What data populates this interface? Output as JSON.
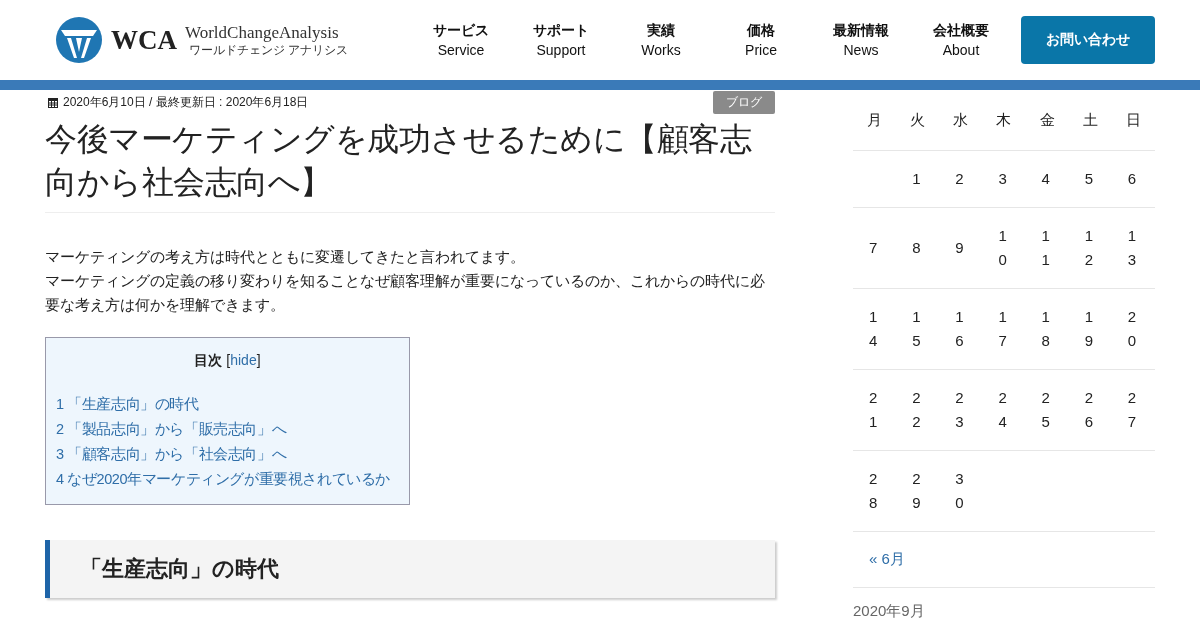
{
  "header": {
    "logo_mark": "WCA",
    "logo_name": "WorldChangeAnalysis",
    "logo_kana": "ワールドチェンジ アナリシス",
    "nav": [
      {
        "ja": "サービス",
        "en": "Service"
      },
      {
        "ja": "サポート",
        "en": "Support"
      },
      {
        "ja": "実績",
        "en": "Works"
      },
      {
        "ja": "価格",
        "en": "Price"
      },
      {
        "ja": "最新情報",
        "en": "News"
      },
      {
        "ja": "会社概要",
        "en": "About"
      }
    ],
    "contact_button": "お問い合わせ"
  },
  "article": {
    "dates": "2020年6月10日 / 最終更新日 : 2020年6月18日",
    "category": "ブログ",
    "title": "今後マーケティングを成功させるために【顧客志向から社会志向へ】",
    "paragraphs": [
      "マーケティングの考え方は時代とともに変遷してきたと言われてます。",
      "マーケティングの定義の移り変わりを知ることなぜ顧客理解が重要になっているのか、これからの時代に必要な考え方は何かを理解できます。"
    ],
    "toc": {
      "title": "目次",
      "toggle_open": "[",
      "toggle": "hide",
      "toggle_close": "]",
      "items": [
        "1 「生産志向」の時代",
        "2 「製品志向」から「販売志向」へ",
        "3 「顧客志向」から「社会志向」へ",
        "4 なぜ2020年マーケティングが重要視されているか"
      ]
    },
    "section_heading": "「生産志向」の時代"
  },
  "sidebar": {
    "calendar": {
      "weekdays": [
        "月",
        "火",
        "水",
        "木",
        "金",
        "土",
        "日"
      ],
      "weeks": [
        [
          {
            "kind": "blank"
          },
          {
            "kind": "day",
            "day": "1"
          },
          {
            "kind": "day",
            "day": "2"
          },
          {
            "kind": "day",
            "day": "3"
          },
          {
            "kind": "day",
            "day": "4"
          },
          {
            "kind": "day",
            "day": "5"
          },
          {
            "kind": "day",
            "day": "6"
          }
        ],
        [
          {
            "kind": "day",
            "day": "7"
          },
          {
            "kind": "day",
            "day": "8"
          },
          {
            "kind": "day",
            "day": "9"
          },
          {
            "kind": "day",
            "day": "10"
          },
          {
            "kind": "day",
            "day": "11"
          },
          {
            "kind": "day",
            "day": "12"
          },
          {
            "kind": "day",
            "day": "13"
          }
        ],
        [
          {
            "kind": "day",
            "day": "14"
          },
          {
            "kind": "day",
            "day": "15"
          },
          {
            "kind": "day",
            "day": "16"
          },
          {
            "kind": "day",
            "day": "17"
          },
          {
            "kind": "day",
            "day": "18"
          },
          {
            "kind": "day",
            "day": "19"
          },
          {
            "kind": "day",
            "day": "20"
          }
        ],
        [
          {
            "kind": "day",
            "day": "21"
          },
          {
            "kind": "day",
            "day": "22"
          },
          {
            "kind": "day",
            "day": "23"
          },
          {
            "kind": "day",
            "day": "24"
          },
          {
            "kind": "day",
            "day": "25"
          },
          {
            "kind": "day",
            "day": "26"
          },
          {
            "kind": "day",
            "day": "27"
          }
        ],
        [
          {
            "kind": "day",
            "day": "28"
          },
          {
            "kind": "day",
            "day": "29"
          },
          {
            "kind": "day",
            "day": "30"
          },
          {
            "kind": "blank"
          },
          {
            "kind": "blank"
          },
          {
            "kind": "blank"
          },
          {
            "kind": "blank"
          }
        ]
      ],
      "prev_link": "« 6月"
    },
    "next_heading": "2020年9月"
  }
}
